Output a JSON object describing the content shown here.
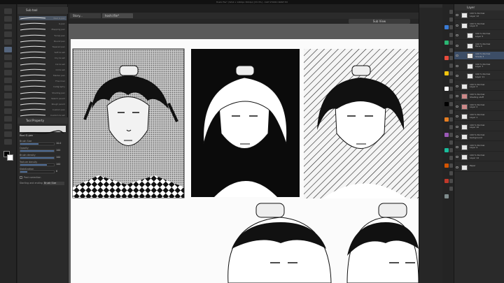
{
  "app": {
    "title": "Hoshi File* (3214 x 1460px 300dpi) [33.3%] - CLIP STUDIO PAINT EX"
  },
  "tabs": [
    {
      "label": "Story..."
    },
    {
      "label": "hoshi file*"
    }
  ],
  "navigator": {
    "label": "Sub View"
  },
  "subtool": {
    "header": "Sub tool",
    "selected_label": "Real G-pen",
    "brushes": [
      {
        "label": "Real G-pen"
      },
      {
        "label": "G-pen"
      },
      {
        "label": "Mapping pen"
      },
      {
        "label": "Turnip pen"
      },
      {
        "label": "Round pen"
      },
      {
        "label": "Tapered pen"
      },
      {
        "label": "Soft brush"
      },
      {
        "label": "Dry brush"
      },
      {
        "label": "Ink brush"
      },
      {
        "label": "Oil brush"
      },
      {
        "label": "Marker pen"
      },
      {
        "label": "Fine liner"
      },
      {
        "label": "Calligraphy"
      },
      {
        "label": "Shading pen"
      },
      {
        "label": "Sketch pencil"
      },
      {
        "label": "Rough pencil"
      },
      {
        "label": "Custom pen"
      },
      {
        "label": "Custom brush"
      }
    ]
  },
  "tool_property": {
    "header": "Tool Property",
    "rows": [
      {
        "label": "Brush Size",
        "value": "10.0",
        "level": 0.55
      },
      {
        "label": "Opacity",
        "value": "100",
        "level": 1.0
      },
      {
        "label": "Brush density",
        "value": "100",
        "level": 1.0
      },
      {
        "label": "Texture density",
        "value": "100",
        "level": 0.8
      },
      {
        "label": "Stabilization",
        "value": "6",
        "level": 0.2
      }
    ],
    "checkbox_label": "Post correction",
    "dropdown_label": "Starting and ending",
    "dropdown_value": "Brush Size"
  },
  "layers": {
    "header": "Layer",
    "items": [
      {
        "name": "100 % Normal\nLayer 12"
      },
      {
        "name": "100 % Normal\nLayer 8"
      },
      {
        "name": "100 % Normal\nLayer 5"
      },
      {
        "name": "100 % Normal\nFace 4"
      },
      {
        "name": "100 % Normal\nShade 3"
      },
      {
        "name": "100 % Normal\nLayer 7"
      },
      {
        "name": "100 % Normal\nLayer 11"
      },
      {
        "name": "100 % Normal\nLayer 3"
      },
      {
        "name": "100 % Normal\nShading stuff"
      },
      {
        "name": "100 % Normal\nLayer 2"
      },
      {
        "name": "100 % Normal\nLayer 1"
      },
      {
        "name": "100 % Normal\nLayer 10"
      },
      {
        "name": "100 % Normal\nbackground"
      },
      {
        "name": "100 % Normal\nLayer 9"
      },
      {
        "name": "100 % Normal\nLayer 14"
      },
      {
        "name": "Paper"
      }
    ]
  },
  "colors": {
    "swatches": [
      "#3a7bd5",
      "#2bb673",
      "#e84c3d",
      "#f1c40f",
      "#ffffff",
      "#000000",
      "#e67e22",
      "#9b59b6",
      "#1abc9c",
      "#d35400",
      "#c0392b",
      "#7f8c8d"
    ],
    "accent_selection": "#3c4d66"
  }
}
